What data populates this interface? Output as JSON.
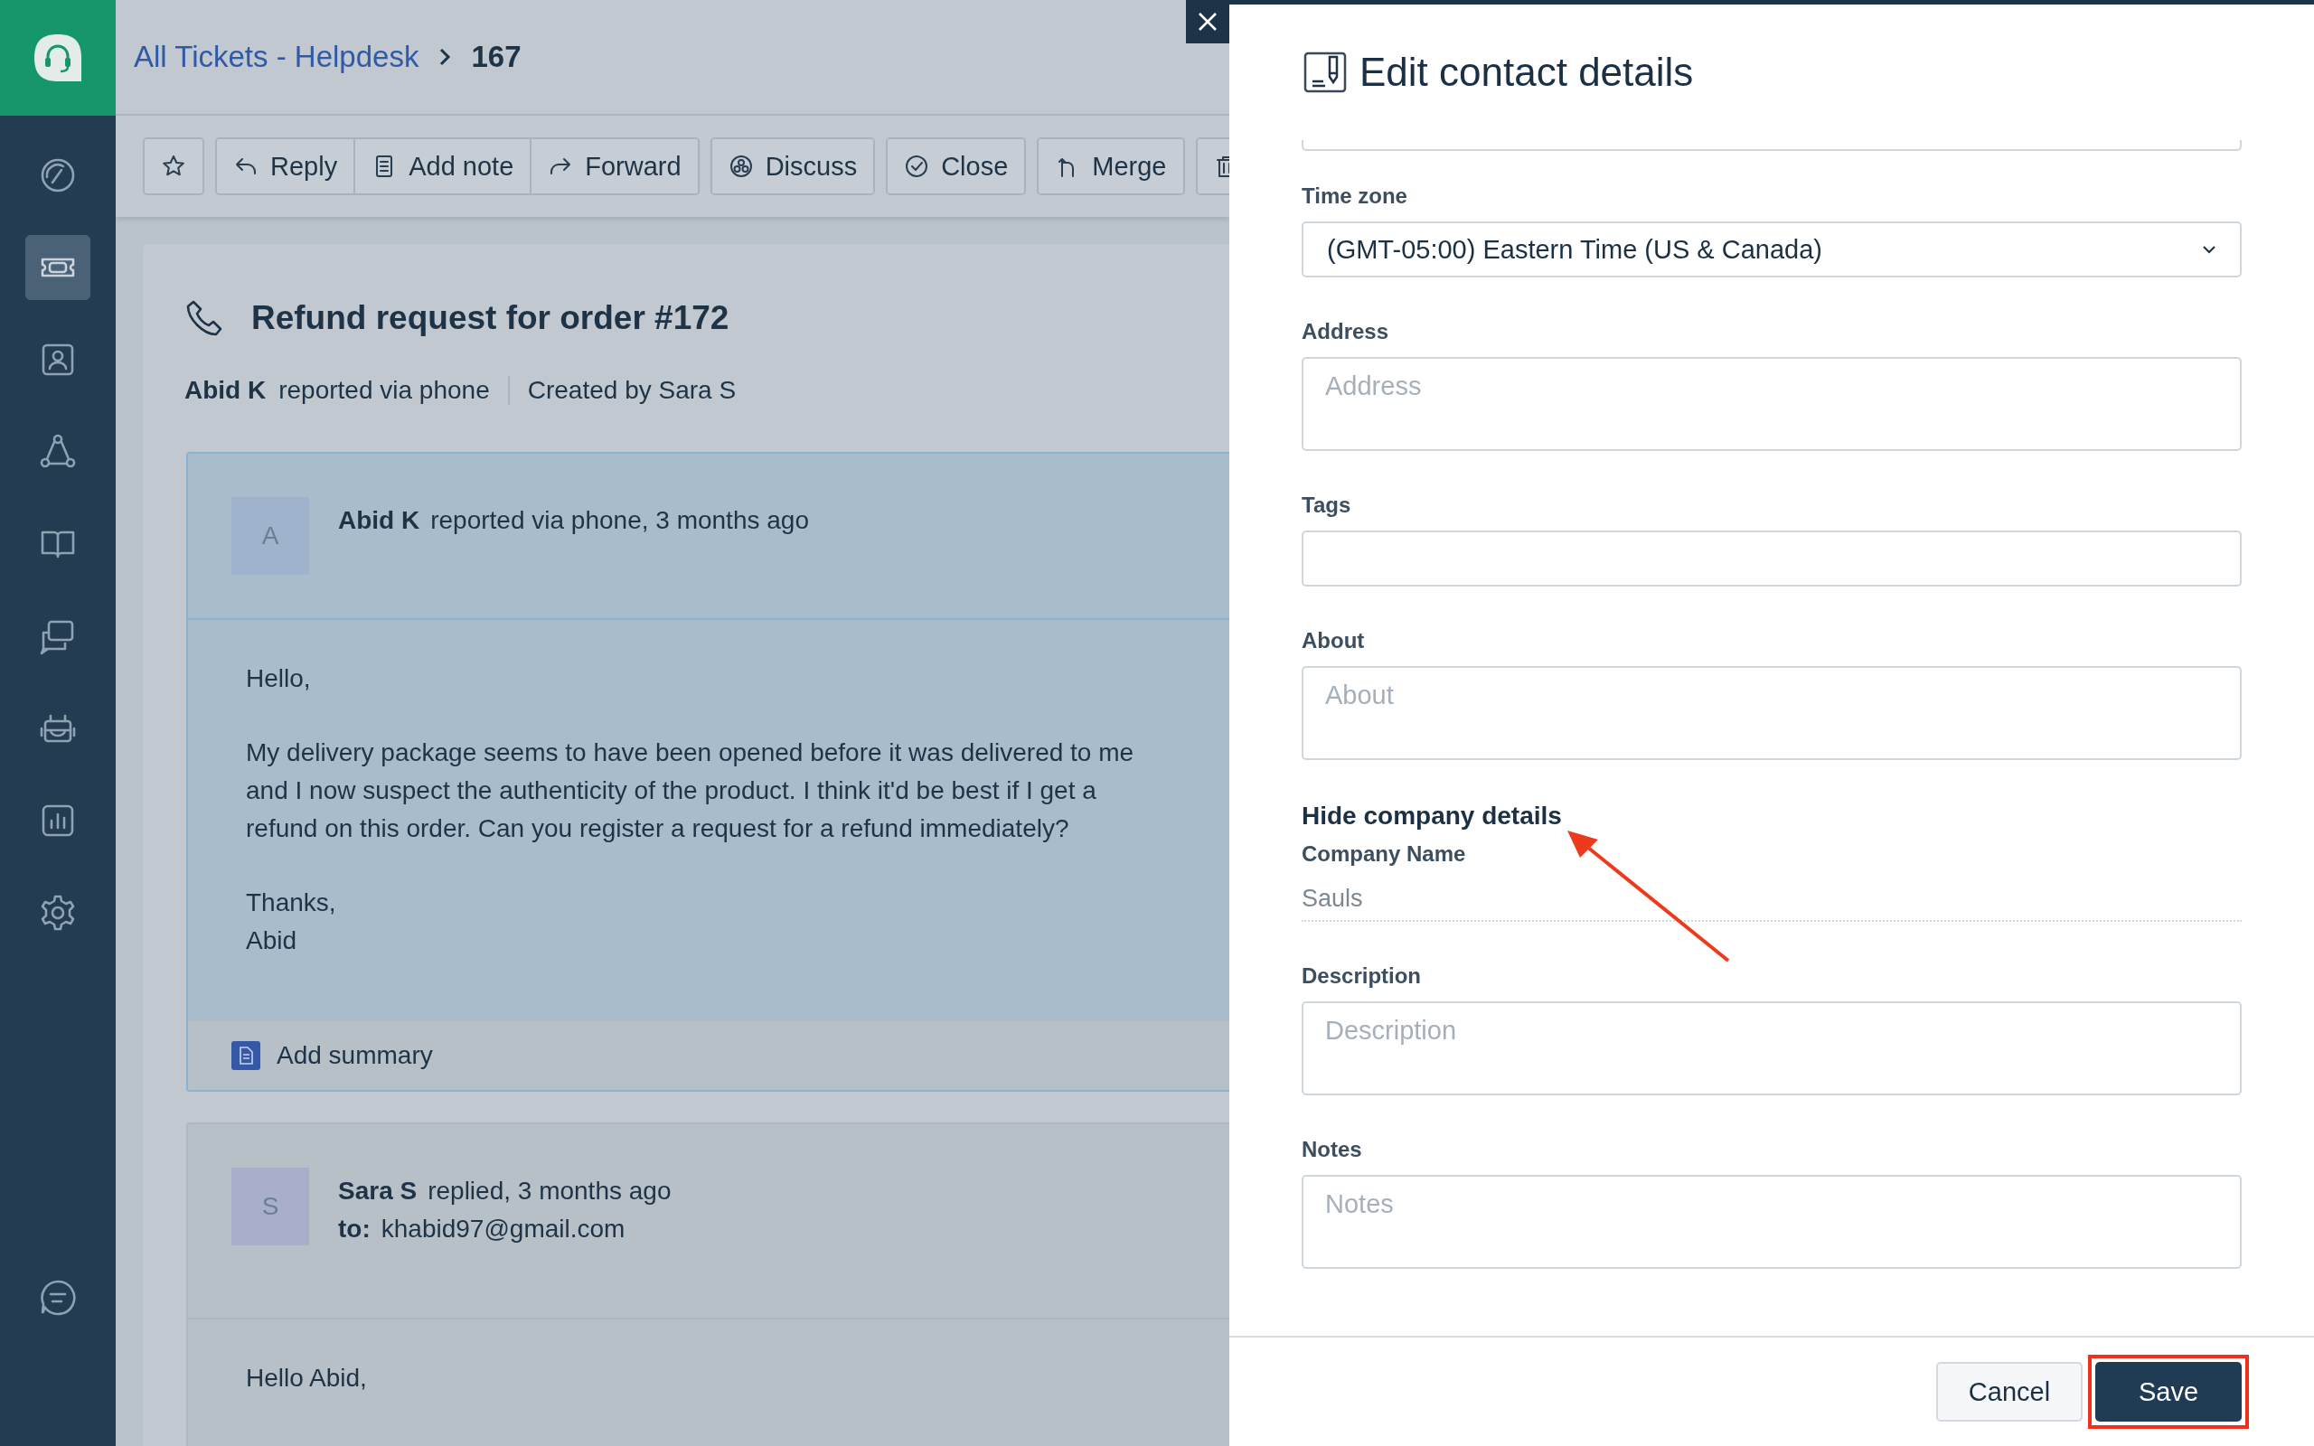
{
  "sidebar": {
    "items": [
      {
        "kind": "dashboard",
        "selected": false
      },
      {
        "kind": "tickets",
        "selected": true
      },
      {
        "kind": "contacts",
        "selected": false
      },
      {
        "kind": "groups",
        "selected": false
      },
      {
        "kind": "book",
        "selected": false
      },
      {
        "kind": "chat",
        "selected": false
      },
      {
        "kind": "bot",
        "selected": false
      },
      {
        "kind": "reports",
        "selected": false
      },
      {
        "kind": "settings",
        "selected": false
      }
    ],
    "bottom": {
      "kind": "feedback"
    }
  },
  "breadcrumb": {
    "parent": "All Tickets - Helpdesk",
    "current": "167"
  },
  "toolbar": {
    "groups": [
      [
        {
          "kind": "star"
        }
      ],
      [
        {
          "kind": "reply",
          "label": "Reply"
        },
        {
          "kind": "note",
          "label": "Add note"
        },
        {
          "kind": "forward",
          "label": "Forward"
        }
      ],
      [
        {
          "kind": "discuss",
          "label": "Discuss"
        }
      ],
      [
        {
          "kind": "close",
          "label": "Close"
        }
      ],
      [
        {
          "kind": "merge",
          "label": "Merge"
        }
      ],
      [
        {
          "kind": "delete"
        }
      ]
    ]
  },
  "ticket": {
    "title": "Refund request for order #172",
    "requester": "Abid K",
    "via": "reported via phone",
    "created_by": "Created by Sara S"
  },
  "conversations": [
    {
      "avatar": "A",
      "color": "#9fb4cc",
      "author": "Abid K",
      "action": "reported via phone, 3 months ago",
      "body": [
        "Hello,",
        "My delivery package seems to have been opened before it was delivered to me\nand I now suspect the authenticity of the product. I think it'd be best if I get a\nrefund on this order. Can you register a request for a refund immediately?",
        "Thanks,\nAbid"
      ],
      "summary": "Add summary"
    },
    {
      "avatar": "S",
      "color": "#a9afca",
      "author": "Sara S",
      "action": "replied, 3 months ago",
      "to_label": "to:",
      "to": "khabid97@gmail.com",
      "body": [
        "Hello Abid,"
      ]
    }
  ],
  "drawer": {
    "title": "Edit contact details",
    "fields": [
      {
        "kind": "partial"
      },
      {
        "kind": "select",
        "label": "Time zone",
        "value": "(GMT-05:00) Eastern Time (US & Canada)"
      },
      {
        "kind": "textarea",
        "label": "Address",
        "placeholder": "Address"
      },
      {
        "kind": "input",
        "label": "Tags"
      },
      {
        "kind": "textarea",
        "label": "About",
        "placeholder": "About"
      },
      {
        "kind": "link",
        "text": "Hide company details"
      },
      {
        "kind": "readonly",
        "label": "Company Name",
        "value": "Sauls"
      },
      {
        "kind": "textarea",
        "label": "Description",
        "placeholder": "Description"
      },
      {
        "kind": "textarea",
        "label": "Notes",
        "placeholder": "Notes"
      }
    ],
    "buttons": [
      {
        "kind": "secondary",
        "label": "Cancel",
        "highlighted": false
      },
      {
        "kind": "primary",
        "label": "Save",
        "highlighted": true
      }
    ],
    "annotation": {
      "kind": "arrow"
    }
  }
}
